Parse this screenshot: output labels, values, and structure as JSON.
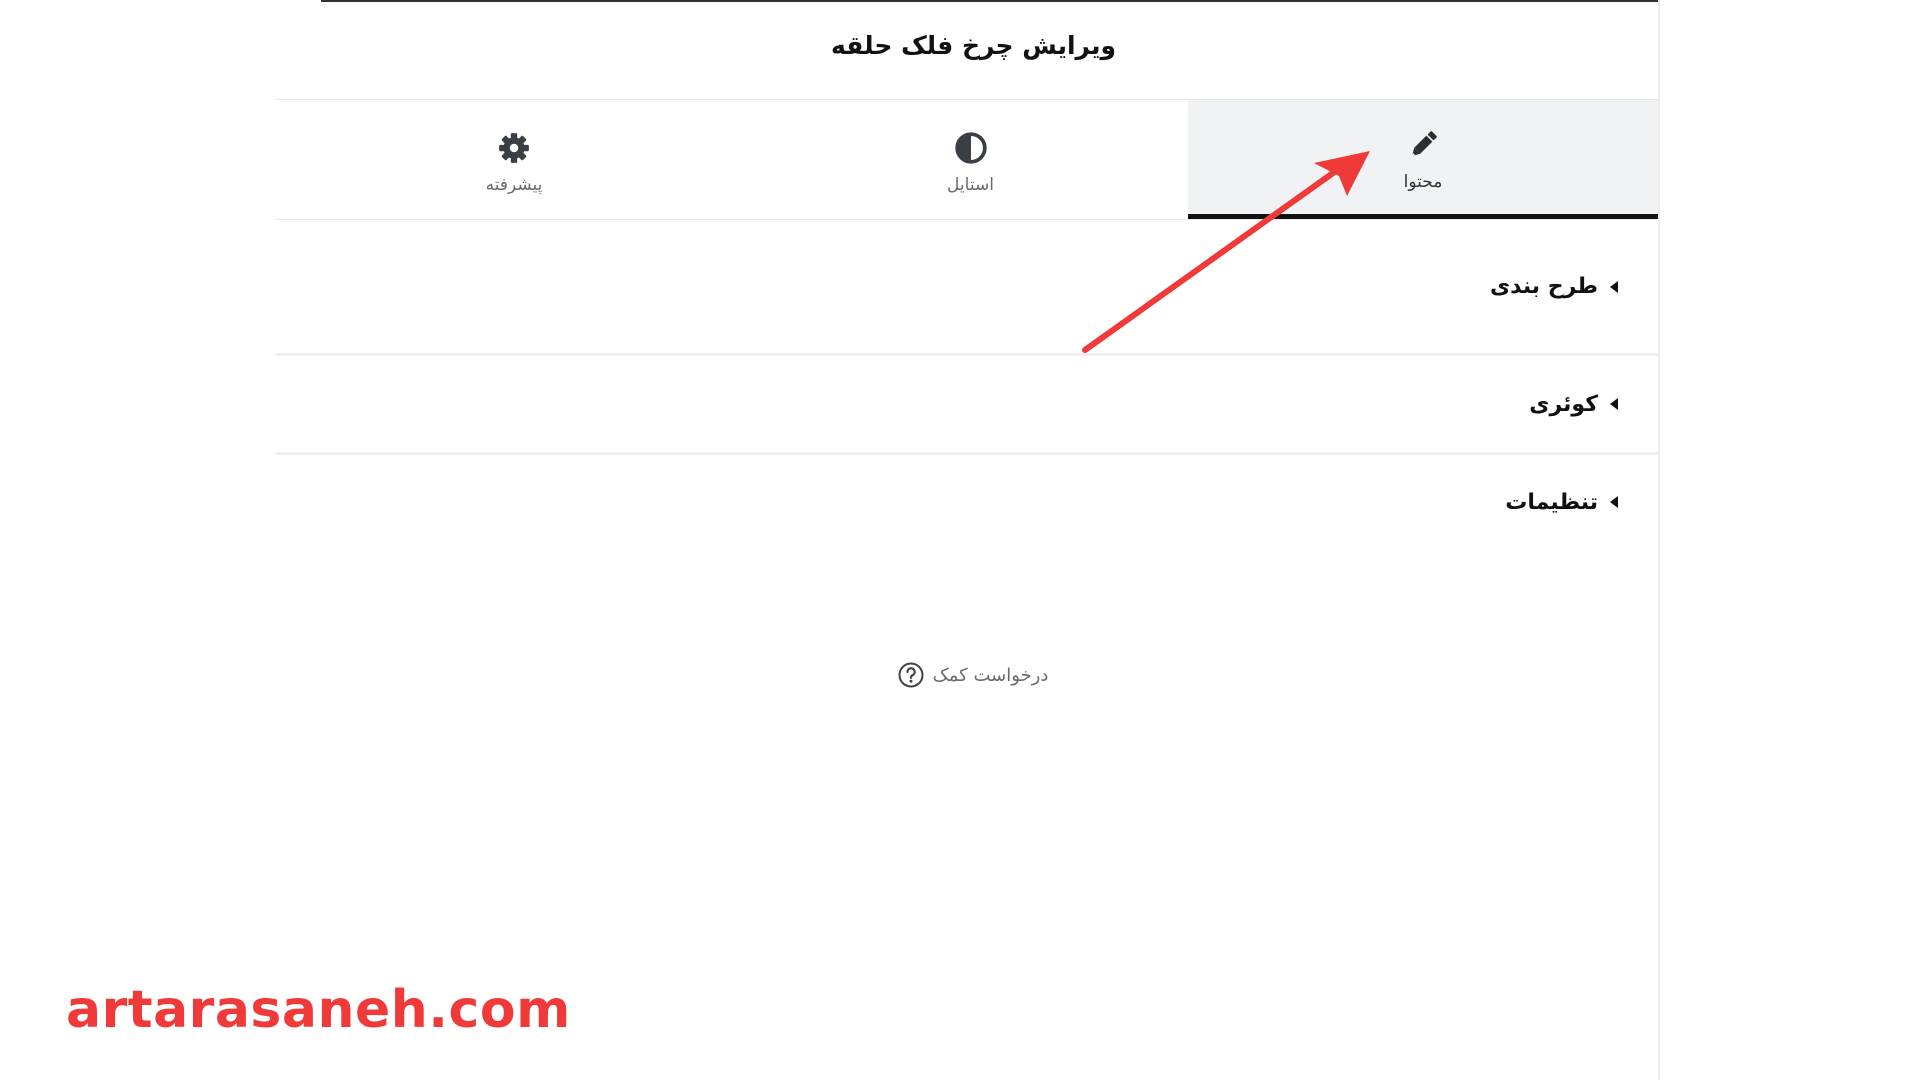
{
  "header": {
    "title": "ویرایش چرخ فلک حلقه"
  },
  "tabs": [
    {
      "label": "پیشرفته",
      "icon": "gear-icon"
    },
    {
      "label": "استایل",
      "icon": "contrast-icon"
    },
    {
      "label": "محتوا",
      "icon": "pencil-icon",
      "active": true
    }
  ],
  "sections": [
    {
      "label": "طرح بندی",
      "icon": "caret-left-icon"
    },
    {
      "label": "کوئری",
      "icon": "caret-left-icon"
    },
    {
      "label": "تنظیمات",
      "icon": "caret-left-icon"
    }
  ],
  "help": {
    "label": "درخواست کمک",
    "icon": "question-circle-icon"
  },
  "watermark": {
    "text": "artarasaneh.com"
  },
  "colors": {
    "accent_red": "#f03a3a",
    "active_tab_bg": "#f1f2f4",
    "active_tab_border": "#111111",
    "icon_dark": "#3a3f45",
    "muted_text": "#6b6b6b"
  }
}
